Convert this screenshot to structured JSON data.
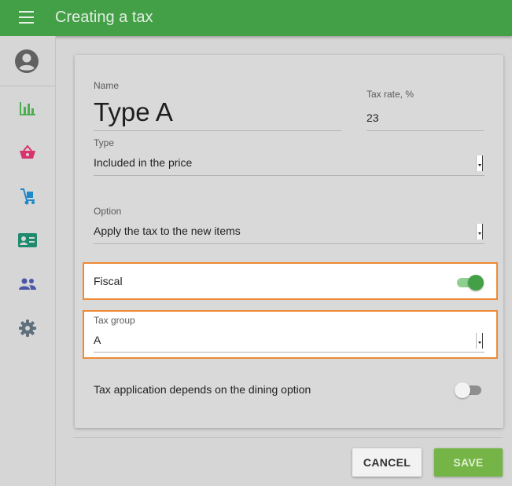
{
  "header": {
    "title": "Creating a tax"
  },
  "sidebar": {
    "items": [
      {
        "icon": "bar-chart-icon",
        "color": "#4caf50"
      },
      {
        "icon": "basket-icon",
        "color": "#d8336d"
      },
      {
        "icon": "hand-truck-icon",
        "color": "#1e88c9"
      },
      {
        "icon": "id-card-icon",
        "color": "#1f8a6e"
      },
      {
        "icon": "people-icon",
        "color": "#4a56a8"
      },
      {
        "icon": "gear-icon",
        "color": "#5f6f7c"
      }
    ]
  },
  "form": {
    "name_label": "Name",
    "name_value": "Type A",
    "rate_label": "Tax rate, %",
    "rate_value": "23",
    "type_label": "Type",
    "type_value": "Included in the price",
    "option_label": "Option",
    "option_value": "Apply the tax to the new items",
    "fiscal_label": "Fiscal",
    "fiscal_on": true,
    "group_label": "Tax group",
    "group_value": "A",
    "dining_label": "Tax application depends on the dining option",
    "dining_on": false
  },
  "actions": {
    "cancel_label": "CANCEL",
    "save_label": "SAVE"
  },
  "colors": {
    "accent": "#43a047",
    "highlight": "#ef8a35",
    "save": "#75b447"
  }
}
